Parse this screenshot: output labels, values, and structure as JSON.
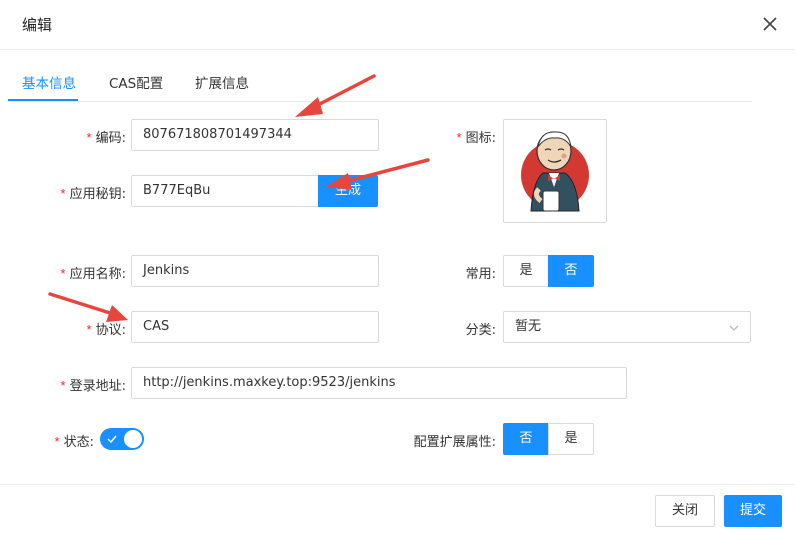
{
  "dialog": {
    "title": "编辑"
  },
  "tabs": [
    {
      "label": "基本信息",
      "active": true
    },
    {
      "label": "CAS配置",
      "active": false
    },
    {
      "label": "扩展信息",
      "active": false
    }
  ],
  "form": {
    "required_mark": "*",
    "code": {
      "label": "编码:",
      "value": "807671808701497344"
    },
    "secret": {
      "label": "应用秘钥:",
      "value": "B777EqBu",
      "generate_label": "生成"
    },
    "icon": {
      "label": "图标:",
      "image": "jenkins-logo"
    },
    "app_name": {
      "label": "应用名称:",
      "value": "Jenkins"
    },
    "common": {
      "label": "常用:",
      "options": [
        "是",
        "否"
      ],
      "selected": "否"
    },
    "protocol": {
      "label": "协议:",
      "value": "CAS"
    },
    "category": {
      "label": "分类:",
      "value": "暂无"
    },
    "login_url": {
      "label": "登录地址:",
      "value": "http://jenkins.maxkey.top:9523/jenkins"
    },
    "status": {
      "label": "状态:",
      "on": true
    },
    "extend_attr": {
      "label": "配置扩展属性:",
      "options": [
        "否",
        "是"
      ],
      "selected": "否"
    }
  },
  "footer": {
    "close_label": "关闭",
    "submit_label": "提交"
  },
  "colors": {
    "primary": "#1890ff",
    "required": "#f5222d",
    "annotation_arrow": "#e8453c"
  }
}
